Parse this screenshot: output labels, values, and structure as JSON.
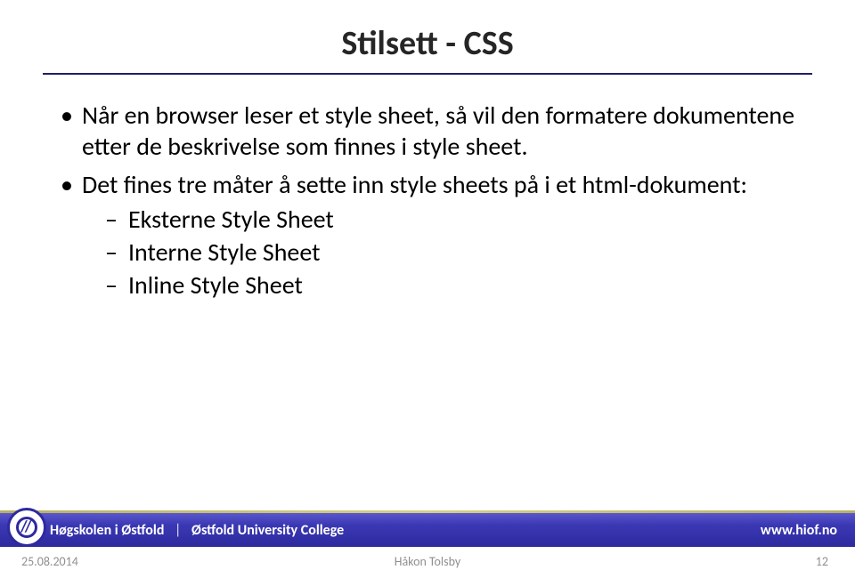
{
  "slide": {
    "title": "Stilsett - CSS",
    "bullets": [
      "Når en browser leser et style sheet, så vil den formatere dokumentene etter de beskrivelse som finnes i style sheet.",
      "Det fines tre måter å sette inn style sheets på i et html-dokument:"
    ],
    "subbullets": [
      "Eksterne Style Sheet",
      "Interne Style Sheet",
      "Inline Style Sheet"
    ]
  },
  "footer": {
    "brand_no": "Høgskolen i Østfold",
    "brand_en": "Østfold University College",
    "url": "www.hiof.no",
    "date": "25.08.2014",
    "author": "Håkon Tolsby",
    "page": "12"
  }
}
